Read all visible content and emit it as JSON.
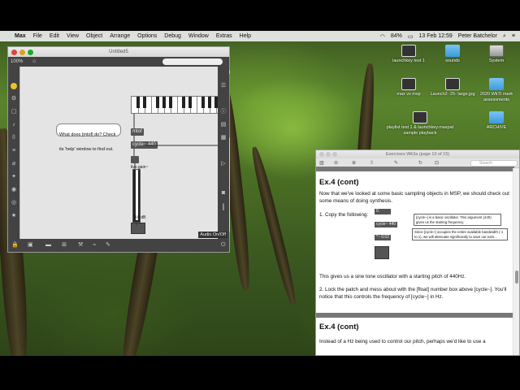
{
  "menubar": {
    "app": "Max",
    "items": [
      "File",
      "Edit",
      "View",
      "Object",
      "Arrange",
      "Options",
      "Debug",
      "Window",
      "Extras",
      "Help"
    ],
    "battery": "84%",
    "datetime": "13 Feb 12:59",
    "user": "Peter Batchelor"
  },
  "max_window": {
    "title": "Untitled5",
    "zoom": "100%",
    "objects": {
      "mtof": "mtof",
      "cycle": "cycle~ 440",
      "gain_label": "live.gain~",
      "db_label": "0.0 dB"
    },
    "comment": "What does [mtof] do? Check its 'help' window to find out.",
    "audio_button": "Audio On/Off"
  },
  "desktop_icons": [
    {
      "label": "launchkey test 1",
      "kind": "thumb"
    },
    {
      "label": "sounds",
      "kind": "folder"
    },
    {
      "label": "System",
      "kind": "disk"
    },
    {
      "label": "max vs msp",
      "kind": "thumb"
    },
    {
      "label": "Launch2- 25- large.jpg",
      "kind": "thumb"
    },
    {
      "label": "2020 WkTI mark assessments",
      "kind": "folder"
    },
    {
      "label": "playlist test 1 & launchkey.maxpat sample playback",
      "kind": "thumb"
    },
    {
      "label": "ARCHIVE",
      "kind": "folder"
    }
  ],
  "exercises_window": {
    "title": "Exercises Wk3a (page 10 of 15)",
    "search_placeholder": "Search",
    "heading1": "Ex.4 (cont)",
    "para1": "Now that we've looked at some basic sampling objects in MSP, we should check out some means of doing synthesis.",
    "step1": "1. Copy the following:",
    "patch_number": "0.",
    "patch_cycle": "cycle~ 440",
    "patch_mult": "*~ 0.02",
    "note1": "[cycle~] is a basic oscillator. This argument (440) gives us the starting frequency.",
    "note2": "Since [cycle~] occupies the entire available bandwidth (-1 to 1), we will attenuate significantly to save our ears...",
    "para2": "This gives us a sine tone oscillator with a starting pitch of 440Hz.",
    "para3": "2. Lock the patch and mess about with the [float] number box above [cycle~]. You'll notice that this controls the frequency of [cycle~] in Hz.",
    "heading2": "Ex.4 (cont)",
    "para4": "Instead of a Hz being used to control our pitch, perhaps we'd like to use a"
  }
}
